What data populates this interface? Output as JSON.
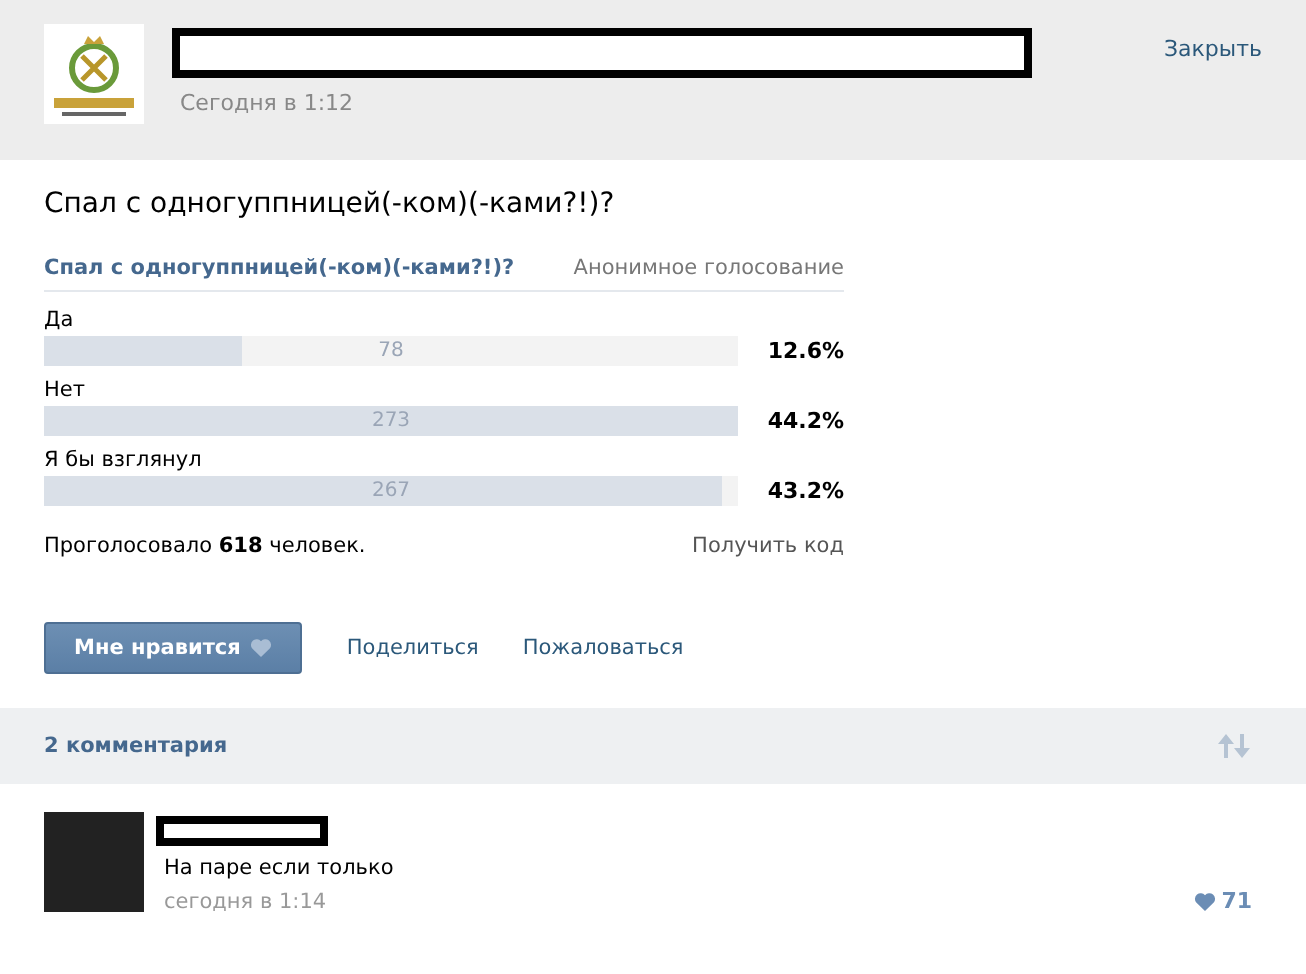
{
  "post": {
    "time": "Сегодня в 1:12",
    "close": "Закрыть",
    "text": "Спал с одногуппницей(-ком)(-ками?!)?"
  },
  "poll": {
    "title": "Спал с одногуппницей(-ком)(-ками?!)?",
    "type": "Анонимное голосование",
    "options": [
      {
        "label": "Да",
        "count": "78",
        "percent": "12.6%",
        "level": 0.285
      },
      {
        "label": "Нет",
        "count": "273",
        "percent": "44.2%",
        "level": 1.0
      },
      {
        "label": "Я бы взглянул",
        "count": "267",
        "percent": "43.2%",
        "level": 0.977
      }
    ],
    "total": "Проголосовало **618** человек.",
    "get_code": "Получить код"
  },
  "actions": {
    "like": "Мне нравится",
    "share": "Поделиться",
    "report": "Пожаловаться"
  },
  "comments": {
    "title": "2 комментария",
    "items": [
      {
        "text": "На паре если только",
        "time": "сегодня в 1:14",
        "likes": "71"
      }
    ]
  }
}
